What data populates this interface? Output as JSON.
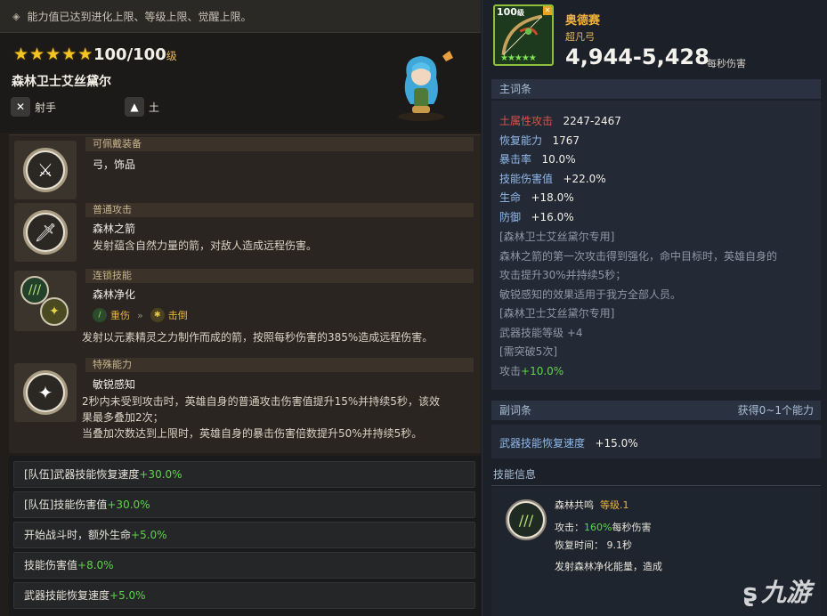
{
  "topbar": {
    "text": "能力值已达到进化上限、等级上限、觉醒上限。"
  },
  "hero": {
    "stars": [
      "★",
      "★",
      "★",
      "★",
      "★"
    ],
    "level_value": "100/100",
    "level_unit": "级",
    "name": "森林卫士艾丝黛尔",
    "role": "射手",
    "element": "土"
  },
  "skills": {
    "equip": {
      "header": "可佩戴装备",
      "text": "弓，饰品"
    },
    "normal": {
      "header": "普通攻击",
      "title": "森林之箭",
      "desc": "发射蕴含自然力量的箭，对敌人造成远程伤害。"
    },
    "chain": {
      "header": "连锁技能",
      "title": "森林净化",
      "from": "重伤",
      "to": "击倒",
      "desc": "发射以元素精灵之力制作而成的箭，按照每秒伤害的385%造成远程伤害。"
    },
    "special": {
      "header": "特殊能力",
      "title": "敏锐感知",
      "desc1": "2秒内未受到攻击时，英雄自身的普通攻击伤害值提升15%并持续5秒，该效",
      "desc2": "果最多叠加2次；",
      "desc3": "当叠加次数达到上限时，英雄自身的暴击伤害倍数提升50%并持续5秒。"
    }
  },
  "bonuses": [
    {
      "label": "[队伍]武器技能恢复速度",
      "value": "+30.0%"
    },
    {
      "label": "[队伍]技能伤害值",
      "value": "+30.0%"
    },
    {
      "label": "开始战斗时，额外生命",
      "value": "+5.0%"
    },
    {
      "label": "技能伤害值",
      "value": "+8.0%"
    },
    {
      "label": "武器技能恢复速度",
      "value": "+5.0%"
    }
  ],
  "weapon": {
    "level": "100",
    "level_unit": "级",
    "name": "奥德赛",
    "rarity": "超凡弓",
    "dps": "4,944-5,428",
    "dps_label": "每秒伤害",
    "stars": "★★★★★"
  },
  "main_stats": {
    "header": "主词条",
    "earth_atk_label": "土属性攻击",
    "earth_atk_value": "2247-2467",
    "recovery_label": "恢复能力",
    "recovery_value": "1767",
    "crit_label": "暴击率",
    "crit_value": "10.0%",
    "skill_dmg_label": "技能伤害值",
    "skill_dmg_value": "+22.0%",
    "hp_label": "生命",
    "hp_value": "+18.0%",
    "def_label": "防御",
    "def_value": "+16.0%",
    "exclusive1": "[森林卫士艾丝黛尔专用]",
    "excl_desc1": "森林之箭的第一次攻击得到强化，命中目标时，英雄自身的",
    "excl_desc2": "攻击提升30%并持续5秒；",
    "excl_desc3": "敏锐感知的效果适用于我方全部人员。",
    "exclusive2": "[森林卫士艾丝黛尔专用]",
    "weapon_skill_lv": "武器技能等级 +4",
    "need_breakthrough": "[需突破5次]",
    "atk_label": "攻击",
    "atk_value": "+10.0%"
  },
  "sub_stats": {
    "header": "副词条",
    "gain": "获得0~1个能力",
    "label": "武器技能恢复速度",
    "value": "+15.0%"
  },
  "skill_info": {
    "header": "技能信息",
    "name": "森林共鸣",
    "level_label": "等级.1",
    "atk_prefix": "攻击：",
    "atk_pct": "160%",
    "atk_suffix": "每秒伤害",
    "cooldown": "恢复时间： 9.1秒",
    "desc": "发射森林净化能量，造成"
  },
  "watermark": "九游"
}
